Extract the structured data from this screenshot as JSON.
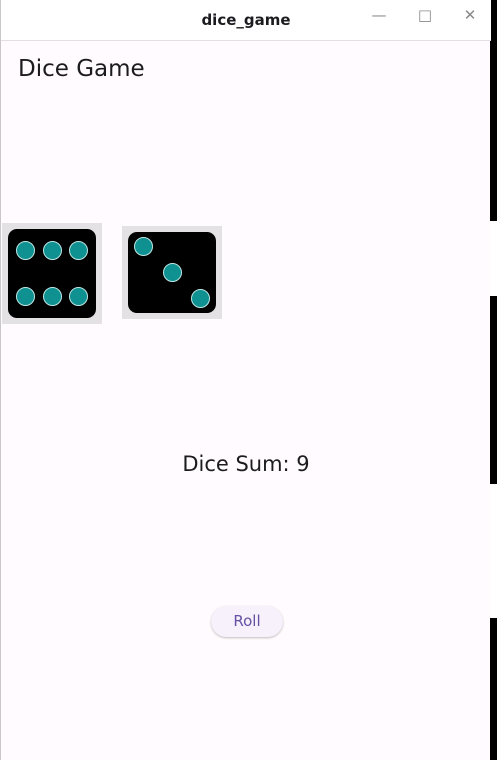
{
  "window": {
    "title": "dice_game",
    "controls": {
      "minimize_icon": "minimize-icon",
      "maximize_icon": "maximize-icon",
      "close_icon": "close-icon"
    }
  },
  "app": {
    "title": "Dice Game"
  },
  "dice": [
    {
      "value": 6
    },
    {
      "value": 3
    }
  ],
  "sum": {
    "text": "Dice Sum: 9"
  },
  "roll_button": {
    "label": "Roll"
  },
  "colors": {
    "background": "#fffbfe",
    "die_face": "#000000",
    "pip": "#0e9190",
    "button_text": "#6750a4"
  }
}
